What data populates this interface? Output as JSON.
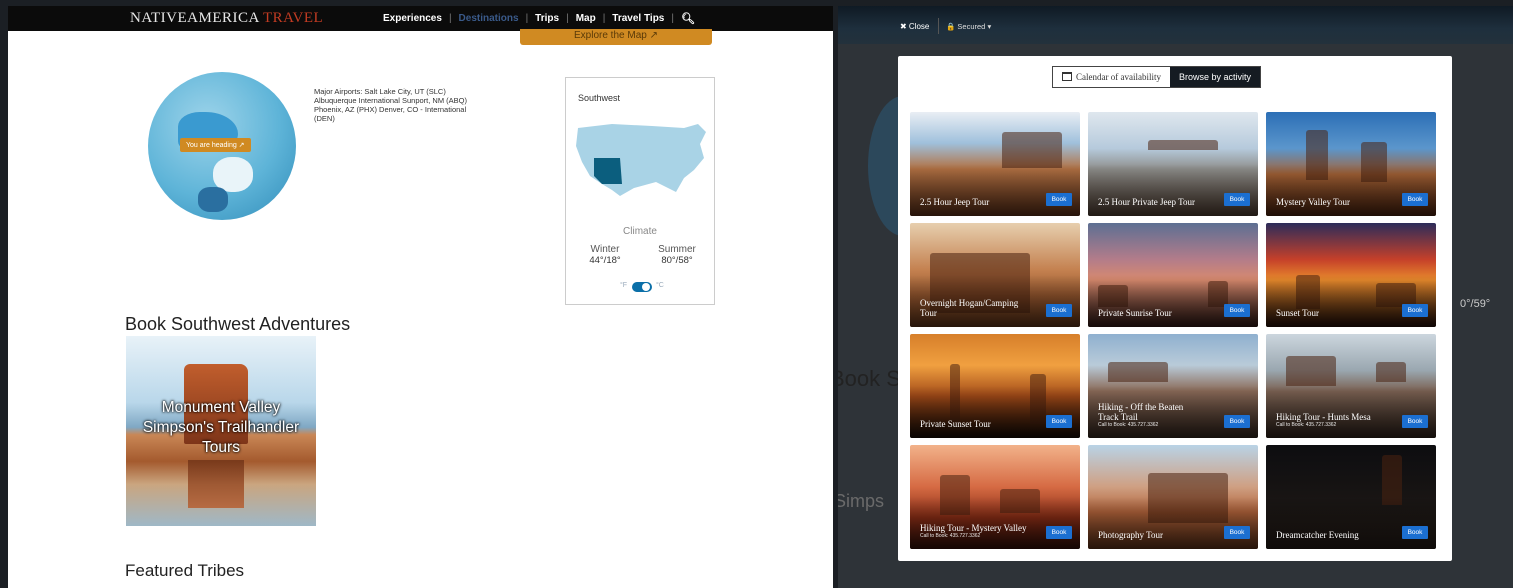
{
  "left": {
    "logo": {
      "main": "NATIVEAMERICA",
      "accent": "TRAVEL"
    },
    "nav": {
      "items": [
        "Experiences",
        "Destinations",
        "Trips",
        "Map",
        "Travel Tips"
      ],
      "active": "Destinations"
    },
    "explore_label": "Explore the Map ↗",
    "globe_pin": "You are heading ↗",
    "airports": "Major Airports: Salt Lake City, UT (SLC) Albuquerque International Sunport, NM (ABQ) Phoenix, AZ (PHX) Denver, CO - International (DEN)",
    "region": {
      "name": "Southwest",
      "climate_label": "Climate",
      "winter": {
        "label": "Winter",
        "temp": "44°/18°"
      },
      "summer": {
        "label": "Summer",
        "temp": "80°/58°"
      },
      "unit_f": "°F",
      "unit_c": "°C"
    },
    "book_heading": "Book Southwest Adventures",
    "tile": {
      "line1": "Monument Valley",
      "line2": "Simpson's Trailhandler",
      "line3": "Tours"
    },
    "featured_heading": "Featured Tribes"
  },
  "right": {
    "close_label": "✖ Close",
    "secured_label": "🔒 Secured ▾",
    "bg_book": "Book S",
    "bg_temp": "0°/59°",
    "bg_simps": "Simps",
    "toggle": {
      "calendar": "Calendar of availability",
      "activity": "Browse by activity"
    },
    "book_label": "Book",
    "activities": [
      {
        "title": "2.5 Hour Jeep Tour",
        "sub": ""
      },
      {
        "title": "2.5 Hour Private Jeep Tour",
        "sub": ""
      },
      {
        "title": "Mystery Valley Tour",
        "sub": ""
      },
      {
        "title": "Overnight Hogan/Camping Tour",
        "sub": ""
      },
      {
        "title": "Private Sunrise Tour",
        "sub": ""
      },
      {
        "title": "Sunset Tour",
        "sub": ""
      },
      {
        "title": "Private Sunset Tour",
        "sub": ""
      },
      {
        "title": "Hiking - Off the Beaten Track Trail",
        "sub": "Call to Book: 435.727.3362"
      },
      {
        "title": "Hiking Tour - Hunts Mesa",
        "sub": "Call to Book: 435.727.3362"
      },
      {
        "title": "Hiking Tour - Mystery Valley",
        "sub": "Call to Book: 435.727.3362"
      },
      {
        "title": "Photography Tour",
        "sub": ""
      },
      {
        "title": "Dreamcatcher Evening",
        "sub": ""
      }
    ]
  },
  "colors": {
    "accent": "#d08a22",
    "book": "#1b6fd1",
    "highlight_state": "#0b5e7e"
  }
}
